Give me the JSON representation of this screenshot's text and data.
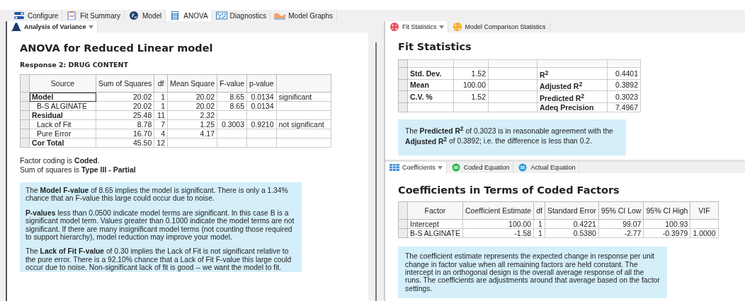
{
  "main_tabs": [
    {
      "label": "Configure",
      "kind": "configure",
      "selected": false
    },
    {
      "label": "Fit Summary",
      "kind": "summary",
      "selected": false
    },
    {
      "label": "Model",
      "kind": "model",
      "selected": false
    },
    {
      "label": "ANOVA",
      "kind": "anova",
      "selected": true
    },
    {
      "label": "Diagnostics",
      "kind": "diagnostics",
      "selected": false
    },
    {
      "label": "Model Graphs",
      "kind": "graphs",
      "selected": false
    }
  ],
  "anova_panel": {
    "tabs": [
      {
        "label": "Analysis of Variance",
        "kind": "bell",
        "selected": true,
        "dropdown": true
      }
    ],
    "title": "ANOVA for Reduced Linear model",
    "response": "Response 2: DRUG CONTENT",
    "table": {
      "columns": [
        "Source",
        "Sum of Squares",
        "df",
        "Mean Square",
        "F-value",
        "p-value"
      ],
      "rows": [
        {
          "kind": "group",
          "source": "Model",
          "sum_of_squares": "20.02",
          "df": "1",
          "mean_square": "20.02",
          "f_value": "8.65",
          "p_value": "0.0134",
          "column_7": "significant",
          "focused": true
        },
        {
          "kind": "term",
          "source": "B-S ALGINATE",
          "sum_of_squares": "20.02",
          "df": "1",
          "mean_square": "20.02",
          "f_value": "8.65",
          "p_value": "0.0134",
          "focused": false
        },
        {
          "kind": "group",
          "source": "Residual",
          "sum_of_squares": "25.48",
          "df": "11",
          "mean_square": "2.32",
          "focused": false
        },
        {
          "kind": "term",
          "source": "Lack of Fit",
          "sum_of_squares": "8.78",
          "df": "7",
          "mean_square": "1.25",
          "f_value": "0.3003",
          "p_value": "0.9210",
          "column_7": "not significant",
          "focused": false
        },
        {
          "kind": "term",
          "source": "Pure Error",
          "sum_of_squares": "16.70",
          "df": "4",
          "mean_square": "4.17",
          "focused": false
        },
        {
          "kind": "group",
          "source": "Cor Total",
          "sum_of_squares": "45.50",
          "df": "12",
          "focused": false
        }
      ]
    },
    "notes": [
      "Factor coding is **Coded**.",
      "Sum of squares is **Type III - Partial**"
    ],
    "explanation": [
      "The **Model F-value** of 8.65 implies the model is significant. There is only a 1.34% chance that an F-value this large could occur due to noise.",
      "**P-values** less than 0.0500 indicate model terms are significant. In this case B is a significant model term. Values greater than 0.1000 indicate the model terms are not significant. If there are many insignificant model terms (not counting those required to support hierarchy), model reduction may improve your model.",
      "The **Lack of Fit F-value** of 0.30 implies the Lack of Fit is not significant relative to the pure error. There is a 92.10% chance that a Lack of Fit F-value this large could occur due to noise. Non-significant lack of fit is good -- we want the model to fit."
    ]
  },
  "fit_panel": {
    "tabs": [
      {
        "label": "Fit Statistics",
        "kind": "red-calc",
        "selected": true,
        "dropdown": true
      },
      {
        "label": "Model Comparison Statistics",
        "kind": "orange-calc",
        "selected": false,
        "dropdown": false
      }
    ],
    "title": "Fit Statistics",
    "table": [
      {
        "label_1": "Std. Dev.",
        "value_1": "1.52",
        "label_2": "R$^{2}$",
        "value_2": "0.4401"
      },
      {
        "label_1": "Mean",
        "value_1": "100.00",
        "label_2": "Adjusted R$^{2}$",
        "value_2": "0.3892"
      },
      {
        "label_1": "C.V. %",
        "value_1": "1.52",
        "label_2": "Predicted R$^{2}$",
        "value_2": "0.3023"
      },
      {
        "label_2": "Adeq Precision",
        "value_2": "7.4967"
      }
    ],
    "explanation": [
      "The **Predicted R$^{2}$** of 0.3023 is in reasonable agreement with the **Adjusted R$^{2}$** of 0.3892; i.e. the difference is less than 0.2."
    ]
  },
  "coefficients_panel": {
    "tabs": [
      {
        "label": "Coefficients",
        "kind": "grid",
        "selected": true,
        "dropdown": true
      },
      {
        "label": "Coded Equation",
        "kind": "green-eq",
        "selected": false,
        "dropdown": false
      },
      {
        "label": "Actual Equation",
        "kind": "blue-eq",
        "selected": false,
        "dropdown": false
      }
    ],
    "title": "Coefficients in Terms of Coded Factors",
    "table": {
      "columns": [
        "Factor",
        "Coefficient Estimate",
        "df",
        "Standard Error",
        "95% CI Low",
        "95% CI High",
        "VIF"
      ],
      "rows": [
        [
          "Intercept",
          "100.00",
          "1",
          "0.4221",
          "99.07",
          "100.93"
        ],
        [
          "B-S ALGINATE",
          "-1.58",
          "1",
          "0.5380",
          "-2.77",
          "-0.3979",
          "1.0000"
        ]
      ]
    },
    "explanation": [
      "The coefficient estimate represents the expected change in response per unit change in factor value when all remaining factors are held constant. The intercept in an orthogonal design is the overall average response of all the runs. The coefficients are adjustments around that average based on the factor settings."
    ]
  }
}
